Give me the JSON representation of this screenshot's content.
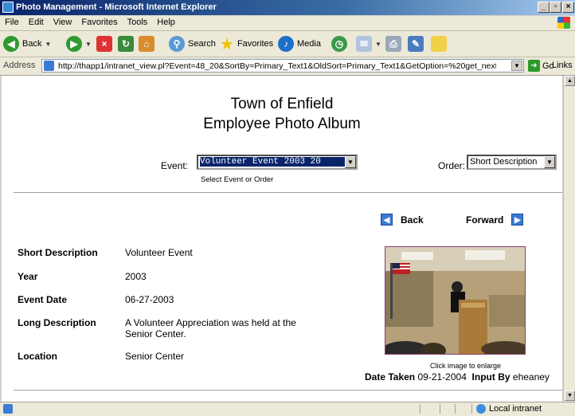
{
  "window": {
    "title": "Photo Management - Microsoft Internet Explorer"
  },
  "menu": {
    "items": [
      "File",
      "Edit",
      "View",
      "Favorites",
      "Tools",
      "Help"
    ]
  },
  "toolbar": {
    "back_label": "Back",
    "search_label": "Search",
    "favorites_label": "Favorites",
    "media_label": "Media"
  },
  "address": {
    "label": "Address",
    "url": "http://thapp1/intranet_view.pl?Event=48_20&SortBy=Primary_Text1&OldSort=Primary_Text1&GetOption=%20get_next",
    "go_label": "Go",
    "links_label": "Links"
  },
  "page": {
    "title_line1": "Town of Enfield",
    "title_line2": "Employee Photo Album",
    "event_label": "Event:",
    "event_selected": "Volunteer Event 2003  20",
    "order_label": "Order:",
    "order_selected": "Short Description",
    "select_hint": "Select Event or Order",
    "back_label": "Back",
    "forward_label": "Forward",
    "details": [
      {
        "label": "Short Description",
        "value": "Volunteer Event"
      },
      {
        "label": "Year",
        "value": "2003"
      },
      {
        "label": "Event Date",
        "value": "06-27-2003"
      },
      {
        "label": "Long Description",
        "value": "A Volunteer Appreciation was held at the Senior Center."
      },
      {
        "label": "Location",
        "value": "Senior Center"
      }
    ],
    "photo_caption": "Click image to enlarge",
    "date_taken_label": "Date Taken",
    "date_taken_value": "09-21-2004",
    "input_by_label": "Input By",
    "input_by_value": "eheaney"
  },
  "status": {
    "zone": "Local intranet"
  }
}
